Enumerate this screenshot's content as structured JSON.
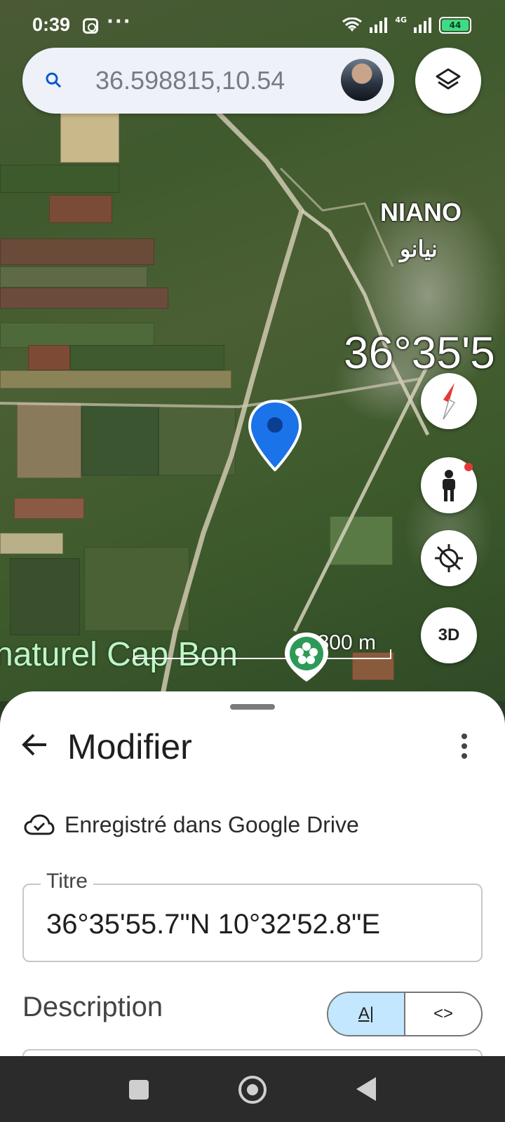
{
  "status_bar": {
    "time": "0:39",
    "more": "···",
    "network": "4G",
    "battery": "44"
  },
  "search": {
    "query": "36.598815,10.54"
  },
  "map": {
    "place_name": "NIANO",
    "place_name_arabic": "نيانو",
    "coordinate_overlay": "36°35'5",
    "poi_label": "naturel Cap Bon",
    "scale_label": "800 m",
    "button_3d": "3D"
  },
  "sheet": {
    "title": "Modifier",
    "saved_status": "Enregistré dans Google Drive",
    "title_field_label": "Titre",
    "title_field_value": "36°35'55.7\"N 10°32'52.8\"E",
    "description_label": "Description",
    "segment_ai": "A|",
    "segment_code": "<>"
  },
  "colors": {
    "pin_blue": "#1a73e8",
    "segment_selected": "#c2e7ff",
    "battery_green": "#3ddc84"
  },
  "icons": [
    "search-icon",
    "layers-icon",
    "compass-icon",
    "pegman-icon",
    "location-off-icon",
    "back-arrow-icon",
    "more-vert-icon",
    "cloud-done-icon"
  ]
}
